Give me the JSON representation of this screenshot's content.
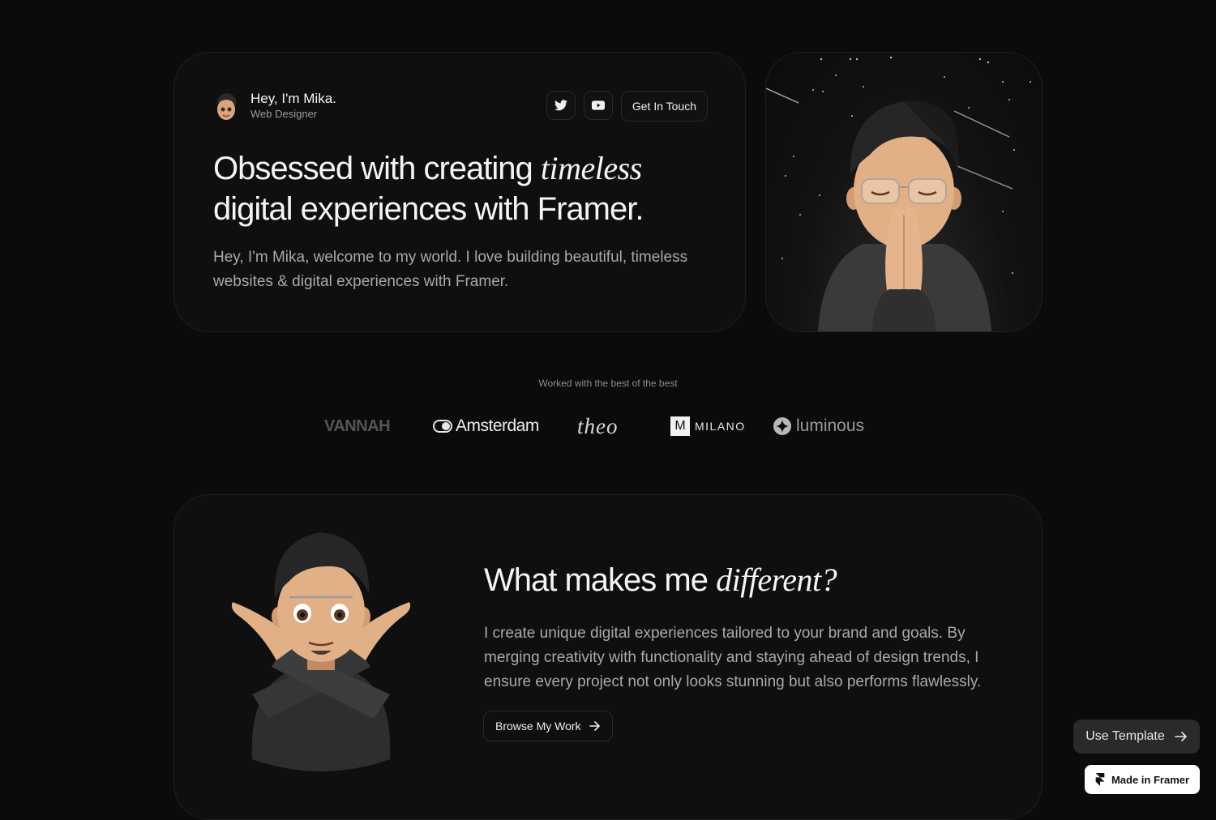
{
  "hero": {
    "name": "Hey, I'm Mika.",
    "role": "Web Designer",
    "contact_label": "Get In Touch",
    "title_start": "Obsessed with creating ",
    "title_emphasis": "timeless",
    "title_end": " digital experiences with Framer.",
    "description": "Hey, I'm Mika, welcome to my world. I love building beautiful, timeless websites & digital experiences with Framer."
  },
  "icons": {
    "twitter": "twitter-icon",
    "youtube": "youtube-icon",
    "arrow": "arrow-right-icon",
    "framer": "framer-icon"
  },
  "clients": {
    "label": "Worked with the best of the best",
    "logos": [
      {
        "name": "VANNAH"
      },
      {
        "name": "Amsterdam"
      },
      {
        "name": "theo"
      },
      {
        "name": "MILANO",
        "badge": "M"
      },
      {
        "name": "luminous"
      }
    ]
  },
  "difference": {
    "title_start": "What makes me ",
    "title_emphasis": "different?",
    "description": "I create unique digital experiences tailored to your brand and goals. By merging creativity with functionality and staying ahead of design trends, I ensure every project not only looks stunning but also performs flawlessly.",
    "button_label": "Browse My Work"
  },
  "floating": {
    "use_template": "Use Template",
    "made_in_framer": "Made in Framer"
  },
  "colors": {
    "background": "#0b0b0b",
    "card": "#0f0f0f",
    "text": "#f5f5f5",
    "muted": "#a9a9a9"
  }
}
